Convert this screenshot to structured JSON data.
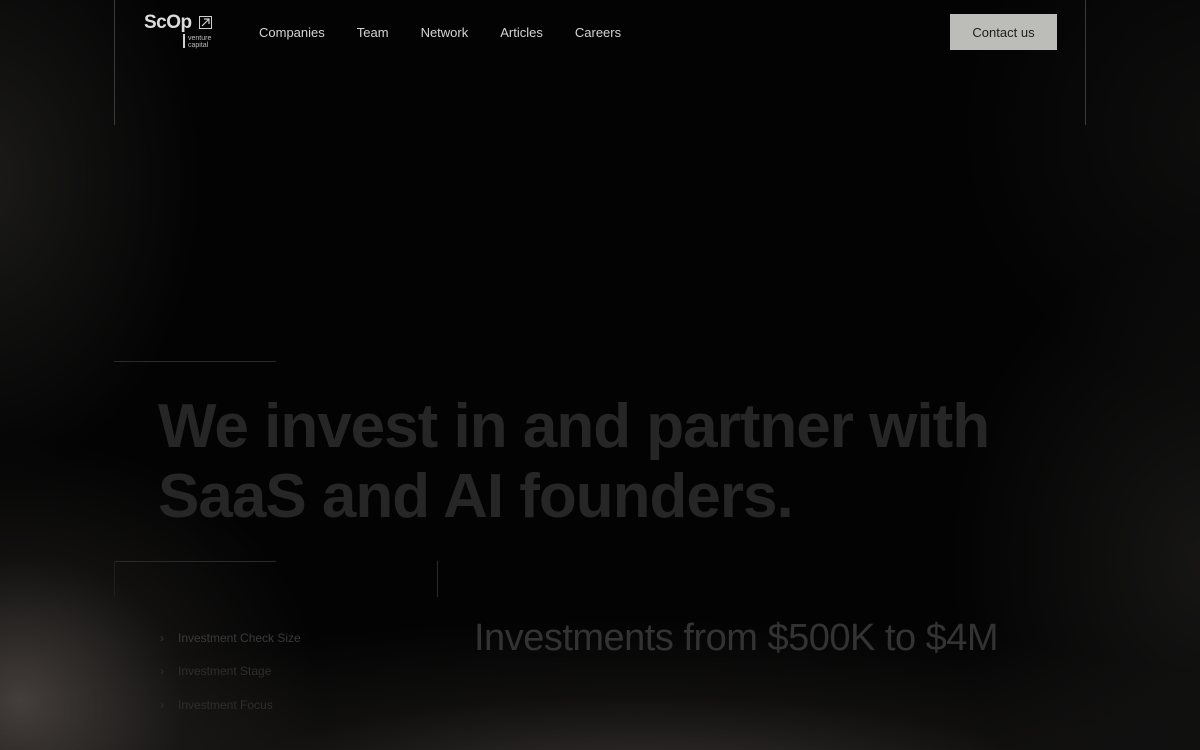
{
  "brand": {
    "name": "ScOp",
    "tagline_line1": "venture",
    "tagline_line2": "capital"
  },
  "nav": {
    "items": [
      {
        "label": "Companies"
      },
      {
        "label": "Team"
      },
      {
        "label": "Network"
      },
      {
        "label": "Articles"
      },
      {
        "label": "Careers"
      }
    ]
  },
  "header": {
    "contact_label": "Contact us"
  },
  "hero": {
    "headline_line1": "We invest in and partner with",
    "headline_line2": "SaaS and AI founders."
  },
  "tabs": {
    "items": [
      {
        "label": "Investment Check Size",
        "icon": "chevron-right-icon",
        "active": true
      },
      {
        "label": "Investment Stage",
        "icon": "chevron-right-icon",
        "active": false
      },
      {
        "label": "Investment Focus",
        "icon": "chevron-right-icon",
        "active": false
      }
    ]
  },
  "detail": {
    "text": "Investments from $500K to $4M"
  },
  "colors": {
    "background": "#030303",
    "button": "#bcbcb8",
    "nav_text": "#d5d5d5",
    "headline": "#262626"
  }
}
